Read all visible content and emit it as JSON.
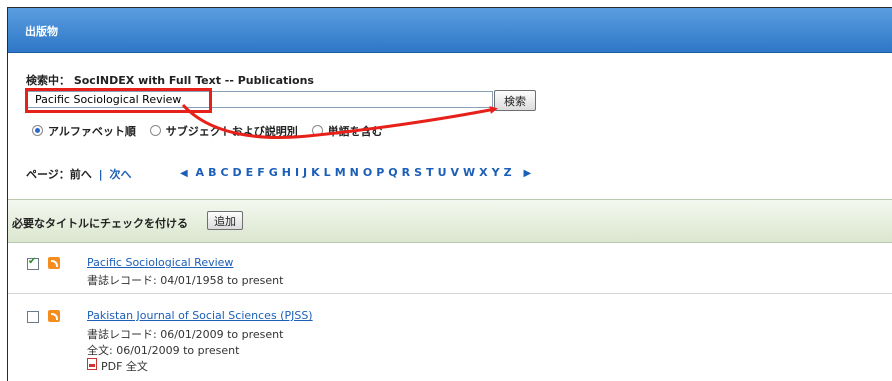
{
  "header": {
    "title": "出版物"
  },
  "search": {
    "label": "検索中： SocINDEX with Full Text -- Publications",
    "value": "Pacific Sociological Review",
    "button_label": "検索"
  },
  "radios": [
    {
      "label": "アルファベット順",
      "checked": true
    },
    {
      "label": "サブジェクトおよび説明別",
      "checked": false
    },
    {
      "label": "単語を含む",
      "checked": false
    }
  ],
  "pager": {
    "label": "ページ：",
    "prev": "前へ",
    "sep": "|",
    "next": "次へ"
  },
  "letters": [
    "A",
    "B",
    "C",
    "D",
    "E",
    "F",
    "G",
    "H",
    "I",
    "J",
    "K",
    "L",
    "M",
    "N",
    "O",
    "P",
    "Q",
    "R",
    "S",
    "T",
    "U",
    "V",
    "W",
    "X",
    "Y",
    "Z"
  ],
  "checkbar": {
    "label": "必要なタイトルにチェックを付ける",
    "add_label": "追加"
  },
  "results": [
    {
      "title": "Pacific Sociological Review",
      "checked": true,
      "record": "書誌レコード: 04/01/1958 to present"
    },
    {
      "title": "Pakistan Journal of Social Sciences (PJSS)",
      "checked": false,
      "record": "書誌レコード: 06/01/2009 to present",
      "fulltext": "全文: 06/01/2009 to present",
      "pdf": "PDF 全文"
    }
  ],
  "colors": {
    "header_blue": "#3a82d0",
    "link_blue": "#1c5fb8",
    "annotation_red": "#e8201a",
    "bar_green": "#dbe6cf"
  }
}
